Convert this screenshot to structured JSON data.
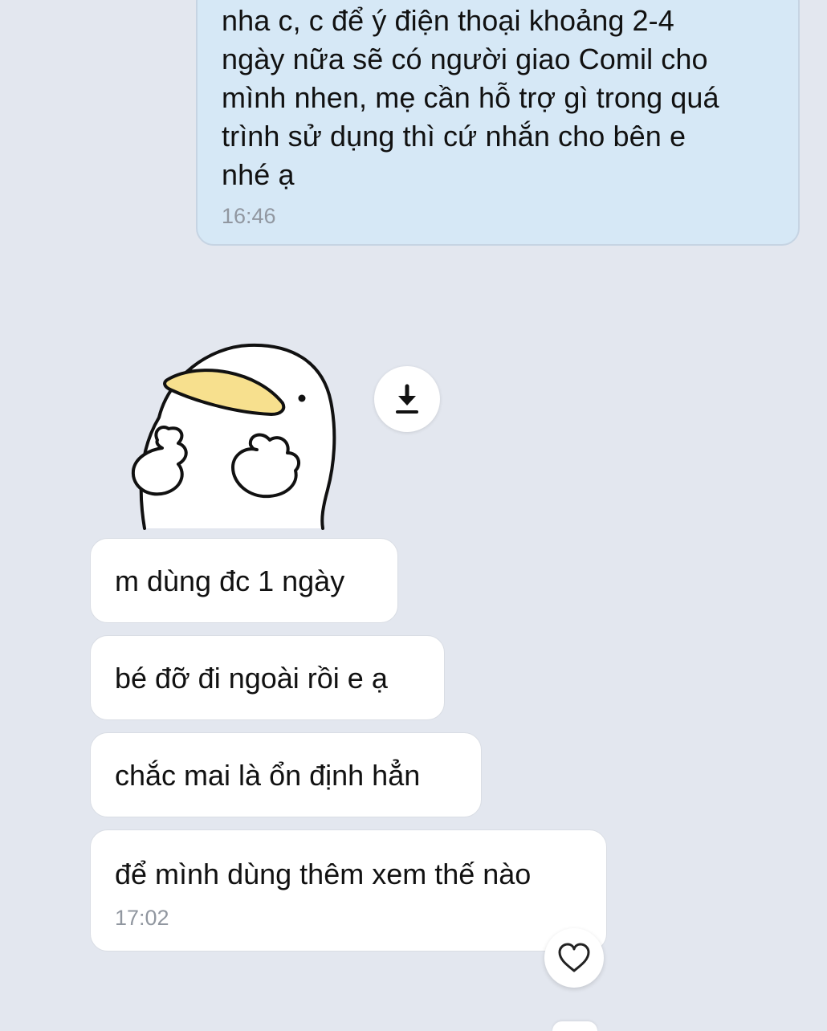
{
  "chat": {
    "outgoing": {
      "text": "nha c, c để ý điện thoại khoảng 2-4\nngày nữa sẽ có người giao Comil cho\nmình nhen, mẹ cần hỗ trợ gì trong quá\ntrình sử dụng thì cứ nhắn cho bên e\nnhé ạ",
      "time": "16:46"
    },
    "sticker": {
      "icon": "penguin-sticker"
    },
    "download_icon": "download-icon",
    "incoming": [
      {
        "text": "m dùng đc 1 ngày"
      },
      {
        "text": "bé đỡ đi ngoài rồi e ạ"
      },
      {
        "text": "chắc mai là ổn định hẳn"
      },
      {
        "text": "để mình dùng thêm xem thế nào",
        "time": "17:02"
      }
    ],
    "react_icon": "heart-icon"
  },
  "colors": {
    "background": "#e3e7ef",
    "outgoing_bubble": "#d6e8f6",
    "incoming_bubble": "#ffffff",
    "timestamp": "#9197a0",
    "beak": "#f7e08e"
  }
}
